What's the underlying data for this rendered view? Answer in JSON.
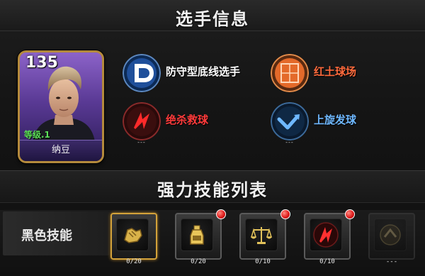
{
  "header": {
    "title": "选手信息"
  },
  "player": {
    "rating": "135",
    "level": "等级.1",
    "name": "纳豆"
  },
  "attributes": [
    {
      "label": "防守型底线选手",
      "sub": "",
      "icon": "defense-d-icon",
      "color": "#ffffff"
    },
    {
      "label": "红土球场",
      "sub": "",
      "icon": "clay-court-icon",
      "color": "#ff6a3c"
    },
    {
      "label": "绝杀救球",
      "sub": "---",
      "icon": "killer-save-icon",
      "color": "#ff3b3b"
    },
    {
      "label": "上旋发球",
      "sub": "---",
      "icon": "topspin-serve-icon",
      "color": "#6fb8ff"
    }
  ],
  "skills_section": {
    "title": "强力技能列表",
    "row_label": "黑色技能",
    "slots": [
      {
        "icon": "hand-strength-icon",
        "count": "0/20",
        "selected": true,
        "new_badge": false,
        "locked": false
      },
      {
        "icon": "bottle-icon",
        "count": "0/20",
        "selected": false,
        "new_badge": true,
        "locked": false
      },
      {
        "icon": "balance-scale-icon",
        "count": "0/10",
        "selected": false,
        "new_badge": true,
        "locked": false
      },
      {
        "icon": "killer-save-icon",
        "count": "0/10",
        "selected": false,
        "new_badge": true,
        "locked": false
      },
      {
        "icon": "topspin-arrow-icon",
        "count": "---",
        "selected": false,
        "new_badge": false,
        "locked": true
      }
    ]
  },
  "colors": {
    "gold": "#d3a23a",
    "level_green": "#5de05a",
    "card_purple": "#5a3a95"
  }
}
